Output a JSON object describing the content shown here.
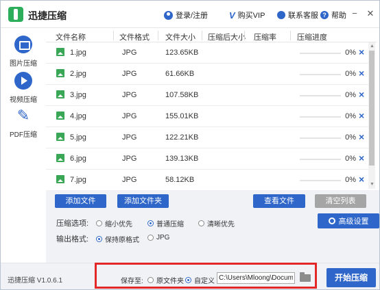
{
  "app": {
    "title": "迅捷压缩",
    "version": "迅捷压缩 V1.0.6.1"
  },
  "header": {
    "login": "登录/注册",
    "buy_vip": "购买VIP",
    "contact": "联系客服",
    "help": "帮助",
    "minimize": "−",
    "close": "✕"
  },
  "sidebar": {
    "items": [
      {
        "label": "图片压缩",
        "icon": "image-icon"
      },
      {
        "label": "视频压缩",
        "icon": "play-icon"
      },
      {
        "label": "PDF压缩",
        "icon": "pdf-icon"
      }
    ]
  },
  "table": {
    "columns": [
      "文件名称",
      "文件格式",
      "文件大小",
      "压缩后大小",
      "压缩率",
      "压缩进度"
    ],
    "rows": [
      {
        "name": "1.jpg",
        "format": "JPG",
        "size": "123.65KB",
        "progress": "0%"
      },
      {
        "name": "2.jpg",
        "format": "JPG",
        "size": "61.66KB",
        "progress": "0%"
      },
      {
        "name": "3.jpg",
        "format": "JPG",
        "size": "107.58KB",
        "progress": "0%"
      },
      {
        "name": "4.jpg",
        "format": "JPG",
        "size": "155.01KB",
        "progress": "0%"
      },
      {
        "name": "5.jpg",
        "format": "JPG",
        "size": "122.21KB",
        "progress": "0%"
      },
      {
        "name": "6.jpg",
        "format": "JPG",
        "size": "139.13KB",
        "progress": "0%"
      },
      {
        "name": "7.jpg",
        "format": "JPG",
        "size": "58.12KB",
        "progress": "0%"
      }
    ]
  },
  "actions": {
    "add_file": "添加文件",
    "add_folder": "添加文件夹",
    "view_files": "查看文件",
    "clear_list": "清空列表"
  },
  "options": {
    "compress_label": "压缩选项:",
    "compress_choices": [
      "缩小优先",
      "普通压缩",
      "清晰优先"
    ],
    "compress_selected": "普通压缩",
    "output_label": "输出格式:",
    "output_choices": [
      "保持原格式",
      "JPG"
    ],
    "output_selected": "保持原格式",
    "advanced": "高级设置"
  },
  "footer": {
    "save_to": "保存至:",
    "save_choices": [
      "原文件夹",
      "自定义"
    ],
    "save_selected": "自定义",
    "path": "C:\\Users\\Mloong\\Documents",
    "start": "开始压缩"
  },
  "colors": {
    "accent": "#2f66c9",
    "highlight_box": "#e32727",
    "file_icon": "#3aa756"
  }
}
